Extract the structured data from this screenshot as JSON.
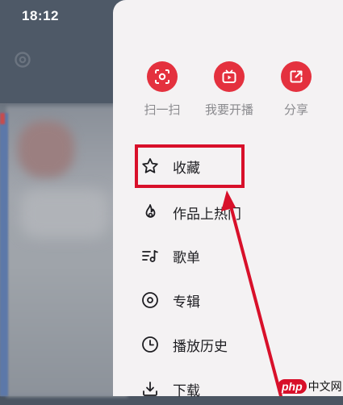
{
  "status_bar": {
    "time": "18:12"
  },
  "quick_actions": [
    {
      "label": "扫一扫",
      "icon": "scan-icon"
    },
    {
      "label": "我要开播",
      "icon": "live-tv-icon"
    },
    {
      "label": "分享",
      "icon": "share-icon"
    }
  ],
  "menu": [
    {
      "label": "收藏",
      "icon": "star-icon"
    },
    {
      "label": "作品上热门",
      "icon": "fire-icon"
    },
    {
      "label": "歌单",
      "icon": "playlist-icon"
    },
    {
      "label": "专辑",
      "icon": "album-icon"
    },
    {
      "label": "播放历史",
      "icon": "clock-icon"
    },
    {
      "label": "下载",
      "icon": "download-icon"
    }
  ],
  "watermark": {
    "brand": "php",
    "text": "中文网"
  },
  "colors": {
    "accent": "#e4313e",
    "highlight": "#d8102a",
    "panel_bg": "#f4f2f3"
  }
}
